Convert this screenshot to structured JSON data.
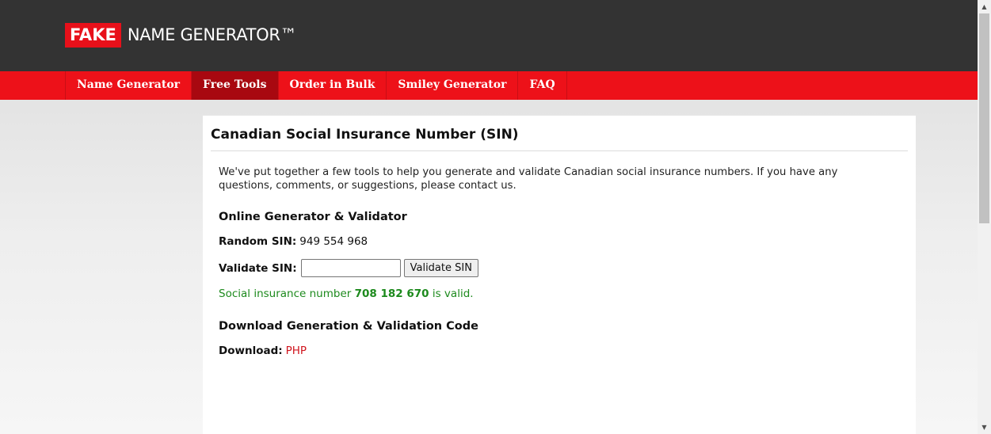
{
  "logo": {
    "fake": "FAKE",
    "rest": "NAME GENERATOR™"
  },
  "nav": [
    {
      "label": "Name Generator"
    },
    {
      "label": "Free Tools",
      "active": true
    },
    {
      "label": "Order in Bulk"
    },
    {
      "label": "Smiley Generator"
    },
    {
      "label": "FAQ"
    }
  ],
  "page": {
    "title": "Canadian Social Insurance Number (SIN)",
    "intro": "We've put together a few tools to help you generate and validate Canadian social insurance numbers. If you have any questions, comments, or suggestions, please contact us.",
    "generator_heading": "Online Generator & Validator",
    "random_label": "Random SIN:",
    "random_value": "949 554 968",
    "validate_label": "Validate SIN:",
    "validate_input_value": "",
    "validate_button": "Validate SIN",
    "result_prefix": "Social insurance number",
    "result_number": "708 182 670",
    "result_suffix": "is valid.",
    "download_heading": "Download Generation & Validation Code",
    "download_label": "Download:",
    "download_link": "PHP"
  },
  "colors": {
    "brand_red": "#ed1119",
    "header_dark": "#333333",
    "valid_green": "#1d8a1d"
  },
  "scrollbar": {
    "up_icon": "arrow-up-icon",
    "down_icon": "arrow-down-icon"
  }
}
